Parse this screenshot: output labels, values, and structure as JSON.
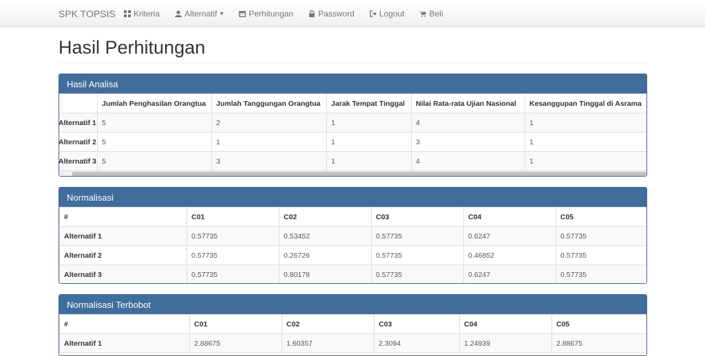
{
  "navbar": {
    "brand": "SPK TOPSIS",
    "items": [
      {
        "label": "Kriteria",
        "icon": "th-icon"
      },
      {
        "label": "Alternatif",
        "icon": "user-icon",
        "dropdown": true
      },
      {
        "label": "Perhitungan",
        "icon": "calendar-icon"
      },
      {
        "label": "Password",
        "icon": "lock-icon"
      },
      {
        "label": "Logout",
        "icon": "logout-icon"
      },
      {
        "label": "Beli",
        "icon": "cart-icon"
      }
    ]
  },
  "page": {
    "title": "Hasil Perhitungan"
  },
  "colors": {
    "panel_heading": "#416d9c",
    "panel_border": "#3f6896"
  },
  "hasil_analisa": {
    "title": "Hasil Analisa",
    "columns": [
      "",
      "Jumlah Penghasilan Orangtua",
      "Jumlah Tanggungan Orangtua",
      "Jarak Tempat Tinggal",
      "Nilai Rata-rata Ujian Nasional",
      "Kesanggupan Tinggal di Asrama"
    ],
    "rows": [
      {
        "label": "Alternatif 1",
        "values": [
          "5",
          "2",
          "1",
          "4",
          "1"
        ]
      },
      {
        "label": "Alternatif 2",
        "values": [
          "5",
          "1",
          "1",
          "3",
          "1"
        ]
      },
      {
        "label": "Alternatif 3",
        "values": [
          "5",
          "3",
          "1",
          "4",
          "1"
        ]
      }
    ]
  },
  "normalisasi": {
    "title": "Normalisasi",
    "columns": [
      "#",
      "C01",
      "C02",
      "C03",
      "C04",
      "C05"
    ],
    "rows": [
      {
        "label": "Alternatif 1",
        "values": [
          "0.57735",
          "0.53452",
          "0.57735",
          "0.6247",
          "0.57735"
        ]
      },
      {
        "label": "Alternatif 2",
        "values": [
          "0.57735",
          "0.26726",
          "0.57735",
          "0.46852",
          "0.57735"
        ]
      },
      {
        "label": "Alternatif 3",
        "values": [
          "0.57735",
          "0.80178",
          "0.57735",
          "0.6247",
          "0.57735"
        ]
      }
    ]
  },
  "normalisasi_terbobot": {
    "title": "Normalisasi Terbobot",
    "columns": [
      "#",
      "C01",
      "C02",
      "C03",
      "C04",
      "C05"
    ],
    "rows": [
      {
        "label": "Alternatif 1",
        "values": [
          "2.88675",
          "1.60357",
          "2.3094",
          "1.24939",
          "2.88675"
        ]
      }
    ]
  }
}
